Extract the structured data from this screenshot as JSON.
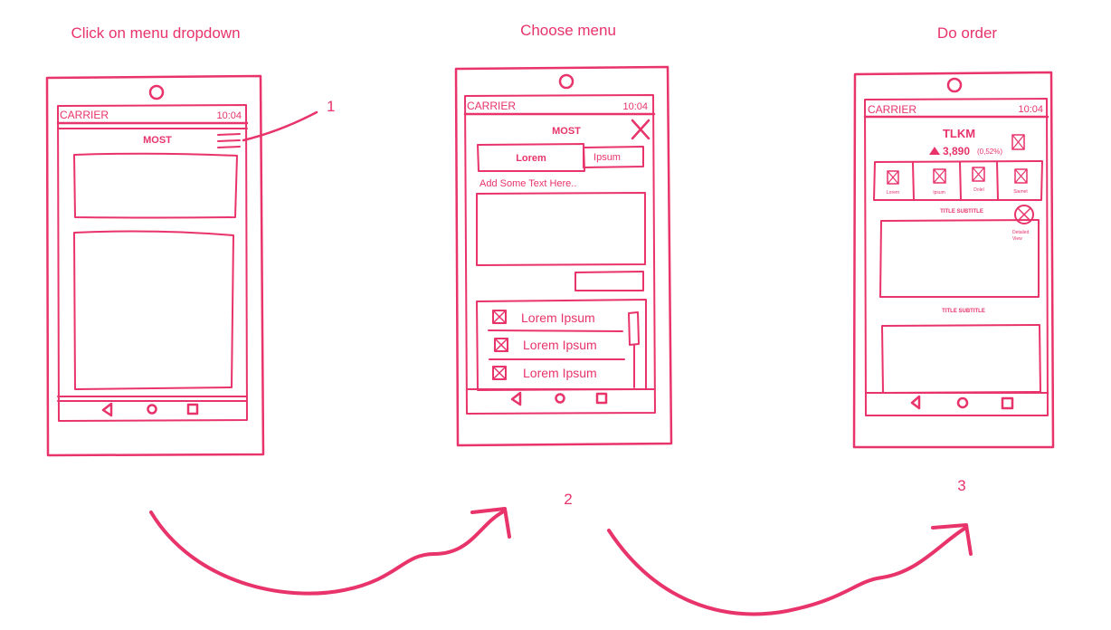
{
  "accent_color": "#e8336b",
  "steps": [
    {
      "number": "1",
      "title": "Click on menu dropdown"
    },
    {
      "number": "2",
      "title": "Choose menu"
    },
    {
      "number": "3",
      "title": "Do order"
    }
  ],
  "phone1": {
    "status": {
      "carrier": "CARRIER",
      "time": "10:04"
    },
    "header_title": "MOST",
    "menu_icon": "hamburger-icon",
    "nav_icons": [
      "back-icon",
      "home-icon",
      "recent-icon"
    ]
  },
  "phone2": {
    "status": {
      "carrier": "CARRIER",
      "time": "10:04"
    },
    "header_title": "MOST",
    "close_icon": "close-icon",
    "tabs": [
      "Lorem",
      "Ipsum"
    ],
    "input_placeholder": "Add Some Text Here..",
    "list_items": [
      "Lorem Ipsum",
      "Lorem Ipsum",
      "Lorem Ipsum"
    ],
    "nav_icons": [
      "back-icon",
      "home-icon",
      "recent-icon"
    ]
  },
  "phone3": {
    "status": {
      "carrier": "CARRIER",
      "time": "10:04"
    },
    "ticker": "TLKM",
    "price": "3,890",
    "change": "(0,52%)",
    "trend_icon": "triangle-up-icon",
    "tiles": [
      "Lorem",
      "Ipsum",
      "Dolel",
      "Siamet"
    ],
    "section_titles": [
      "TITLE SUBTITLE",
      "TITLE SUBTITLE"
    ],
    "detail_label_line1": "Detailed",
    "detail_label_line2": "View",
    "nav_icons": [
      "back-icon",
      "home-icon",
      "recent-icon"
    ]
  }
}
